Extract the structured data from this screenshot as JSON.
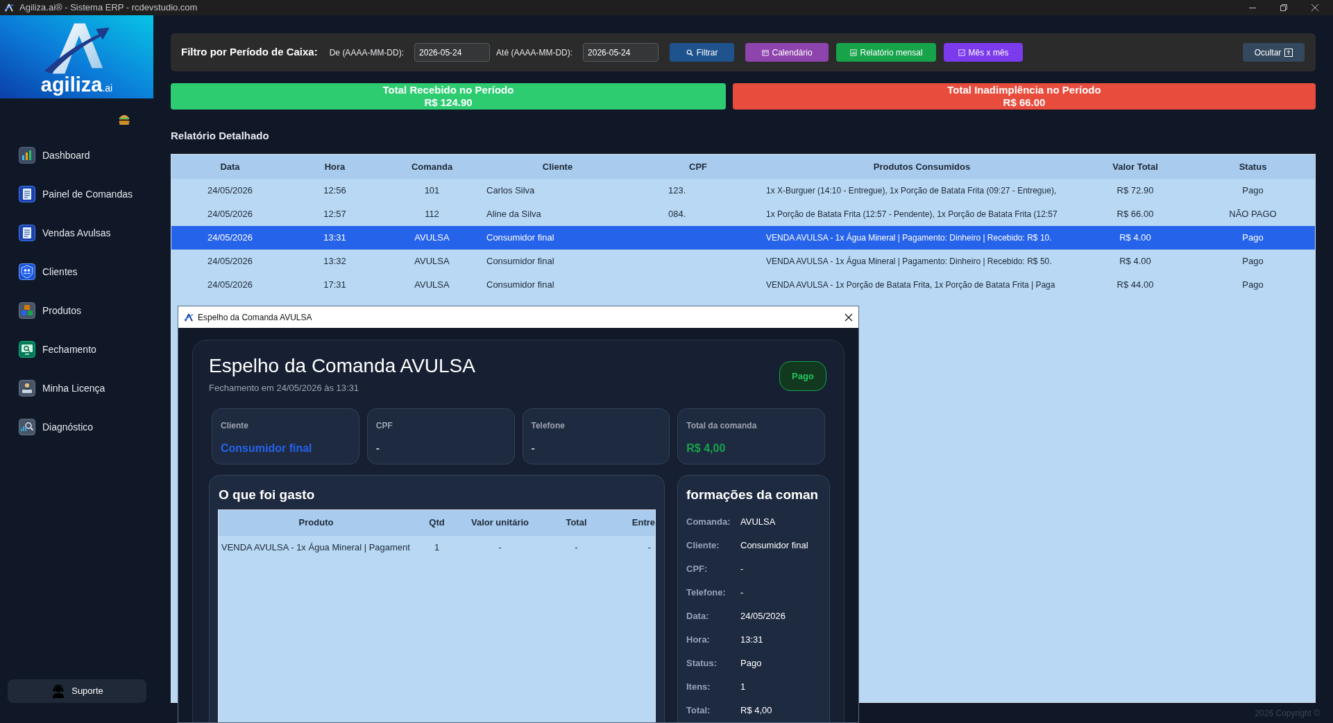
{
  "window": {
    "title": "Agiliza.ai® - Sistema ERP - rcdevstudio.com"
  },
  "sidebar": {
    "logo": {
      "name": "agiliza",
      "suffix": ".ai"
    },
    "items": [
      {
        "label": "Dashboard"
      },
      {
        "label": "Painel de Comandas"
      },
      {
        "label": "Vendas Avulsas"
      },
      {
        "label": "Clientes"
      },
      {
        "label": "Produtos"
      },
      {
        "label": "Fechamento"
      },
      {
        "label": "Minha Licença"
      },
      {
        "label": "Diagnóstico"
      }
    ],
    "support_button": {
      "label": "Suporte"
    }
  },
  "filter_bar": {
    "title": "Filtro por Período de Caixa:",
    "fields": [
      {
        "label": "De (AAAA-MM-DD):",
        "value": "2026-05-24"
      },
      {
        "label": "Até (AAAA-MM-DD):",
        "value": "2026-05-24"
      }
    ],
    "buttons": [
      {
        "label": "Filtrar",
        "kind": "filter"
      },
      {
        "label": "Calendário",
        "kind": "calendar"
      },
      {
        "label": "Relatório mensal",
        "kind": "report"
      },
      {
        "label": "Mês x mês",
        "kind": "compare"
      },
      {
        "label": "Ocultar",
        "kind": "hide"
      }
    ]
  },
  "totals": [
    {
      "label": "Total Recebido no Período",
      "value": "R$ 124.90",
      "kind": "received"
    },
    {
      "label": "Total Inadimplência no Período",
      "value": "R$ 66.00",
      "kind": "overdue"
    }
  ],
  "report": {
    "title": "Relatório Detalhado",
    "table": {
      "columns": [
        "Data",
        "Hora",
        "Comanda",
        "Cliente",
        "CPF",
        "Produtos Consumidos",
        "Valor Total",
        "Status"
      ],
      "rows": [
        {
          "date": "24/05/2026",
          "time": "12:56",
          "order": "101",
          "client": "Carlos Silva",
          "cpf": "123.",
          "products": "1x X-Burguer (14:10 - Entregue), 1x Porção de Batata Frita (09:27 - Entregue),",
          "total": "R$ 72.90",
          "status": "Pago",
          "selected": false
        },
        {
          "date": "24/05/2026",
          "time": "12:57",
          "order": "112",
          "client": "Aline da Silva",
          "cpf": "084.",
          "products": "1x Porção de Batata Frita (12:57 - Pendente), 1x Porção de Batata Frita (12:57",
          "total": "R$ 66.00",
          "status": "NÃO PAGO",
          "selected": false
        },
        {
          "date": "24/05/2026",
          "time": "13:31",
          "order": "AVULSA",
          "client": "Consumidor final",
          "products": "VENDA AVULSA - 1x Água Mineral | Pagamento: Dinheiro | Recebido: R$ 10.",
          "total": "R$ 4.00",
          "status": "Pago",
          "selected": true
        },
        {
          "date": "24/05/2026",
          "time": "13:32",
          "order": "AVULSA",
          "client": "Consumidor final",
          "products": "VENDA AVULSA - 1x Água Mineral | Pagamento: Dinheiro | Recebido: R$ 50.",
          "total": "R$ 4.00",
          "status": "Pago",
          "selected": false
        },
        {
          "date": "24/05/2026",
          "time": "17:31",
          "order": "AVULSA",
          "client": "Consumidor final",
          "products": "VENDA AVULSA - 1x Porção de Batata Frita, 1x Porção de Batata Frita | Paga",
          "total": "R$ 44.00",
          "status": "Pago",
          "selected": false
        }
      ]
    }
  },
  "dialog": {
    "title": "Espelho da Comanda AVULSA",
    "heading": "Espelho da Comanda AVULSA",
    "subtitle": "Fechamento em 24/05/2026 às 13:31",
    "status_badge": "Pago",
    "summary_cards": [
      {
        "label": "Cliente",
        "value": "Consumidor final",
        "kind": "client"
      },
      {
        "label": "CPF",
        "value": "-",
        "kind": "text"
      },
      {
        "label": "Telefone",
        "value": "-",
        "kind": "text"
      },
      {
        "label": "Total da comanda",
        "value": "R$ 4,00",
        "kind": "money"
      }
    ],
    "items_panel": {
      "title": "O que foi gasto",
      "columns": [
        "Produto",
        "Qtd",
        "Valor unitário",
        "Total",
        "Entre"
      ],
      "rows": [
        [
          "VENDA AVULSA - 1x Água Mineral | Pagament",
          "1",
          "-",
          "-",
          "-"
        ]
      ]
    },
    "info_panel": {
      "title": "formações da coman",
      "fields": [
        {
          "label": "Comanda:",
          "value": "AVULSA"
        },
        {
          "label": "Cliente:",
          "value": "Consumidor final"
        },
        {
          "label": "CPF:",
          "value": "-"
        },
        {
          "label": "Telefone:",
          "value": "-"
        },
        {
          "label": "Data:",
          "value": "24/05/2026"
        },
        {
          "label": "Hora:",
          "value": "13:31"
        },
        {
          "label": "Status:",
          "value": "Pago"
        },
        {
          "label": "Itens:",
          "value": "1"
        },
        {
          "label": "Total:",
          "value": "R$ 4,00"
        }
      ]
    }
  },
  "footer": {
    "copyright": "2026 Copyright ©"
  }
}
